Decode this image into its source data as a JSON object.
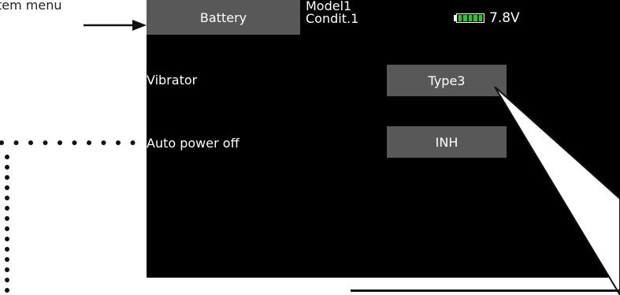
{
  "annotation": {
    "menu_label": "tem menu"
  },
  "header": {
    "menu_button_label": "Battery",
    "model_name": "Model1",
    "condition": "Condit.1",
    "battery_voltage": "7.8V",
    "battery_level": 1.0,
    "battery_color": "#22cc22"
  },
  "settings": [
    {
      "label": "Vibrator",
      "value": "Type3"
    },
    {
      "label": "Auto power off",
      "value": "INH"
    }
  ],
  "icons": {
    "battery": "battery-icon",
    "pointer_arrow": "arrow-right-icon"
  }
}
